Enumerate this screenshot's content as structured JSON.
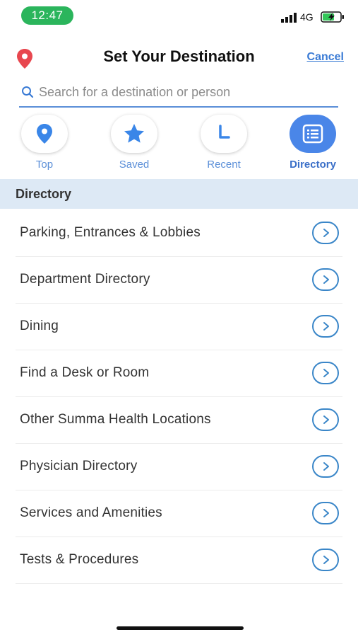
{
  "status_bar": {
    "time": "12:47",
    "network": "4G",
    "time_pill_color": "#2bb55c",
    "battery_icon": "battery-charging-icon",
    "signal_icon": "cellular-signal-icon"
  },
  "header": {
    "title": "Set Your Destination",
    "cancel_label": "Cancel",
    "logo_icon": "map-pin-icon",
    "accent_color": "#3a7bd5"
  },
  "search": {
    "placeholder": "Search for a destination or person",
    "value": ""
  },
  "tabs": [
    {
      "label": "Top",
      "icon": "map-pin-icon",
      "active": false
    },
    {
      "label": "Saved",
      "icon": "star-icon",
      "active": false
    },
    {
      "label": "Recent",
      "icon": "clock-icon",
      "active": false
    },
    {
      "label": "Directory",
      "icon": "list-icon",
      "active": true
    }
  ],
  "section": {
    "title": "Directory"
  },
  "directory_items": [
    {
      "label": "Parking, Entrances & Lobbies"
    },
    {
      "label": "Department Directory"
    },
    {
      "label": "Dining"
    },
    {
      "label": "Find a Desk or Room"
    },
    {
      "label": "Other Summa Health Locations"
    },
    {
      "label": "Physician Directory"
    },
    {
      "label": "Services and Amenities"
    },
    {
      "label": "Tests & Procedures"
    }
  ]
}
